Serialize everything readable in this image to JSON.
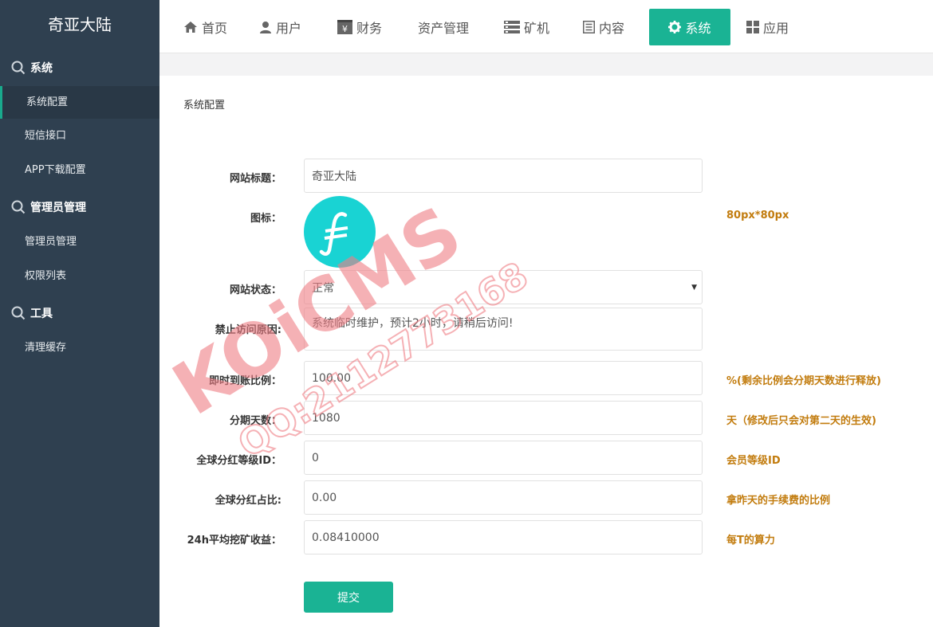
{
  "sidebar": {
    "brand": "奇亚大陆",
    "groups": [
      {
        "title": "系统",
        "items": [
          "系统配置",
          "短信接口",
          "APP下载配置"
        ]
      },
      {
        "title": "管理员管理",
        "items": [
          "管理员管理",
          "权限列表"
        ]
      },
      {
        "title": "工具",
        "items": [
          "清理缓存"
        ]
      }
    ]
  },
  "nav": {
    "items": [
      {
        "label": "首页",
        "icon": "home-icon"
      },
      {
        "label": "用户",
        "icon": "user-icon"
      },
      {
        "label": "财务",
        "icon": "yen-icon"
      },
      {
        "label": "资产管理",
        "icon": ""
      },
      {
        "label": "矿机",
        "icon": "server-icon"
      },
      {
        "label": "内容",
        "icon": "document-icon"
      },
      {
        "label": "系统",
        "icon": "gear-icon",
        "active": true
      },
      {
        "label": "应用",
        "icon": "grid-icon"
      }
    ]
  },
  "page": {
    "title": "系统配置"
  },
  "form": {
    "site_title": {
      "label": "网站标题：",
      "value": "奇亚大陆"
    },
    "icon": {
      "label": "图标：",
      "hint": "80px*80px"
    },
    "site_status": {
      "label": "网站状态：",
      "value": "正常"
    },
    "deny_reason": {
      "label": "禁止访问原因:",
      "value": "系统临时维护，预计2小时，请稍后访问!"
    },
    "instant_ratio": {
      "label": "即时到账比例：",
      "value": "100.00",
      "hint": "%(剩余比例会分期天数进行释放)"
    },
    "installment_days": {
      "label": "分期天数：",
      "value": "1080",
      "hint": "天（修改后只会对第二天的生效)"
    },
    "global_bonus_level": {
      "label": "全球分红等级ID：",
      "value": "0",
      "hint": "会员等级ID"
    },
    "global_bonus_ratio": {
      "label": "全球分红占比:",
      "value": "0.00",
      "hint": "拿昨天的手续费的比例"
    },
    "mining_income": {
      "label": "24h平均挖矿收益：",
      "value": "0.08410000",
      "hint": "每T的算力"
    },
    "submit_label": "提交"
  },
  "watermark": {
    "brand": "KOiCMS",
    "qq": "QQ:2112773168"
  },
  "colors": {
    "sidebar_bg": "#2f4050",
    "accent": "#1ab394",
    "hint": "#c27c0e",
    "logo": "#19d3d3",
    "watermark": "#f07e85"
  }
}
